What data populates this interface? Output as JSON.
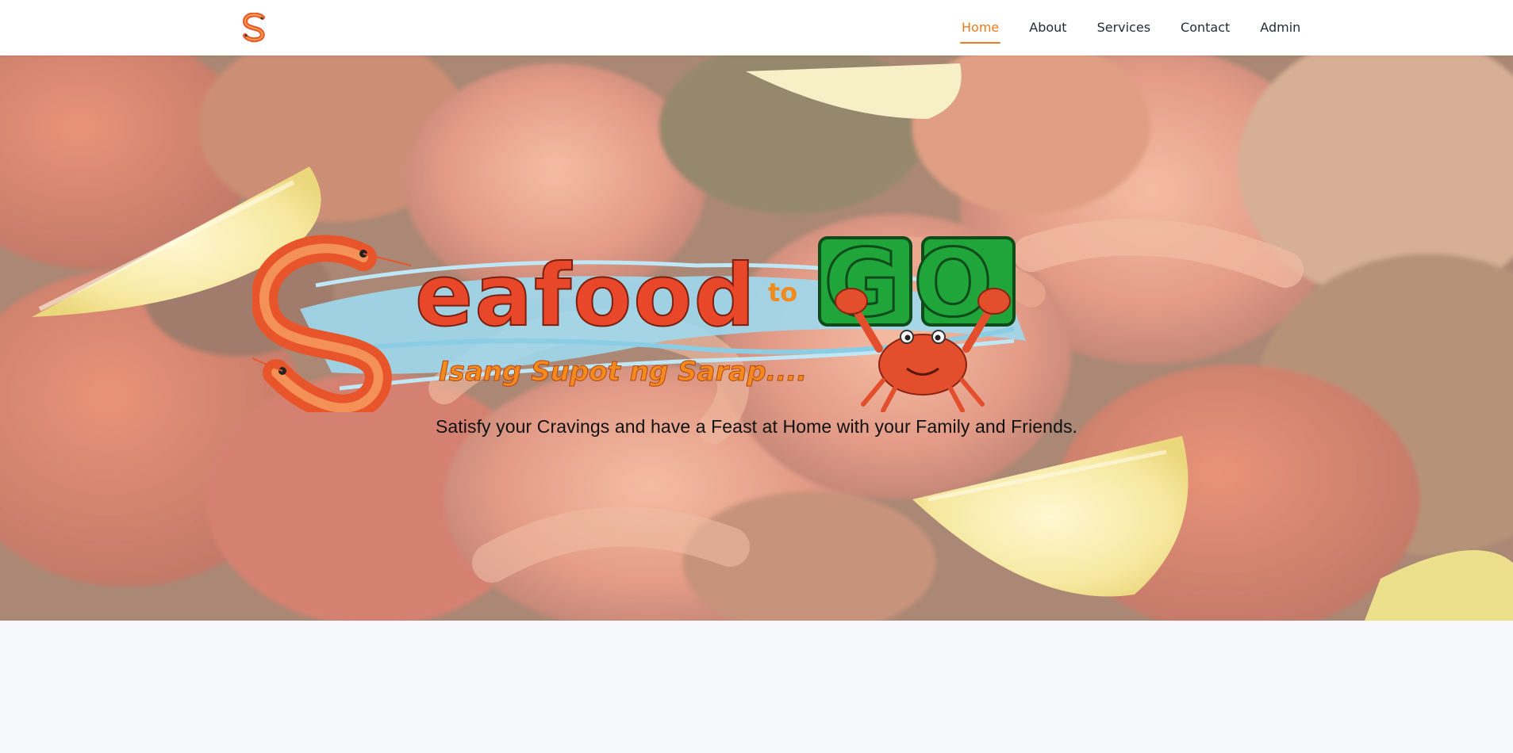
{
  "nav": {
    "logo_icon": "shrimp-s-logo-icon",
    "items": [
      {
        "label": "Home",
        "active": true
      },
      {
        "label": "About",
        "active": false
      },
      {
        "label": "Services",
        "active": false
      },
      {
        "label": "Contact",
        "active": false
      },
      {
        "label": "Admin",
        "active": false
      }
    ]
  },
  "hero": {
    "brand": {
      "name_part1": "eafood",
      "name_connector": "to",
      "name_part2": "GO",
      "slogan": "Isang Supot ng Sarap....",
      "mascot_icon": "crab-mascot-icon",
      "shrimp_icon": "shrimp-s-icon"
    },
    "tagline": "Satisfy your Cravings and have a Feast at Home with your Family and Friends."
  },
  "colors": {
    "accent": "#ec7a1c",
    "brand_red": "#e8472a",
    "brand_green": "#1fa53a",
    "slogan_orange": "#f28a1e"
  }
}
